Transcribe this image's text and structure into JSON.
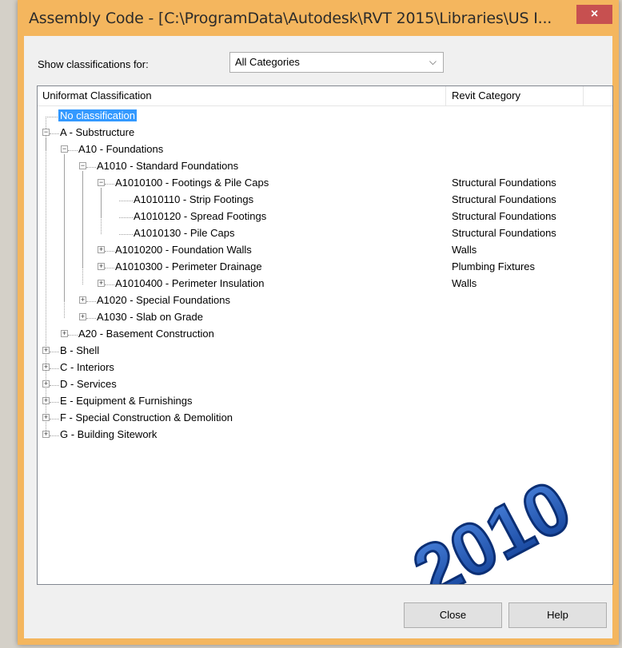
{
  "window": {
    "title": "Assembly Code - [C:\\ProgramData\\Autodesk\\RVT 2015\\Libraries\\US I...",
    "close_glyph": "×"
  },
  "filter": {
    "label": "Show classifications for:",
    "selected": "All Categories",
    "chevron": "⌵"
  },
  "tree": {
    "columns": [
      "Uniformat Classification",
      "Revit Category"
    ],
    "rows": [
      {
        "label": "No classification",
        "category": "",
        "level": 0,
        "toggle": "",
        "selected": true
      },
      {
        "label": "A - Substructure",
        "category": "",
        "level": 0,
        "toggle": "−"
      },
      {
        "label": "A10 - Foundations",
        "category": "",
        "level": 1,
        "toggle": "−"
      },
      {
        "label": "A1010 - Standard Foundations",
        "category": "",
        "level": 2,
        "toggle": "−"
      },
      {
        "label": "A1010100 - Footings & Pile Caps",
        "category": "Structural Foundations",
        "level": 3,
        "toggle": "−"
      },
      {
        "label": "A1010110 - Strip Footings",
        "category": "Structural Foundations",
        "level": 4,
        "toggle": ""
      },
      {
        "label": "A1010120 - Spread Footings",
        "category": "Structural Foundations",
        "level": 4,
        "toggle": ""
      },
      {
        "label": "A1010130 - Pile Caps",
        "category": "Structural Foundations",
        "level": 4,
        "toggle": ""
      },
      {
        "label": "A1010200 - Foundation Walls",
        "category": "Walls",
        "level": 3,
        "toggle": "+"
      },
      {
        "label": "A1010300 - Perimeter Drainage",
        "category": "Plumbing Fixtures",
        "level": 3,
        "toggle": "+"
      },
      {
        "label": "A1010400 - Perimeter Insulation",
        "category": "Walls",
        "level": 3,
        "toggle": "+"
      },
      {
        "label": "A1020 - Special Foundations",
        "category": "",
        "level": 2,
        "toggle": "+"
      },
      {
        "label": "A1030 - Slab on Grade",
        "category": "",
        "level": 2,
        "toggle": "+"
      },
      {
        "label": "A20 - Basement Construction",
        "category": "",
        "level": 1,
        "toggle": "+"
      },
      {
        "label": "B - Shell",
        "category": "",
        "level": 0,
        "toggle": "+"
      },
      {
        "label": "C - Interiors",
        "category": "",
        "level": 0,
        "toggle": "+"
      },
      {
        "label": "D - Services",
        "category": "",
        "level": 0,
        "toggle": "+"
      },
      {
        "label": "E - Equipment & Furnishings",
        "category": "",
        "level": 0,
        "toggle": "+"
      },
      {
        "label": "F - Special Construction & Demolition",
        "category": "",
        "level": 0,
        "toggle": "+"
      },
      {
        "label": "G - Building Sitework",
        "category": "",
        "level": 0,
        "toggle": "+"
      }
    ]
  },
  "watermark": {
    "text": "2010",
    "color": "#1c56b8"
  },
  "buttons": {
    "close": "Close",
    "help": "Help"
  }
}
